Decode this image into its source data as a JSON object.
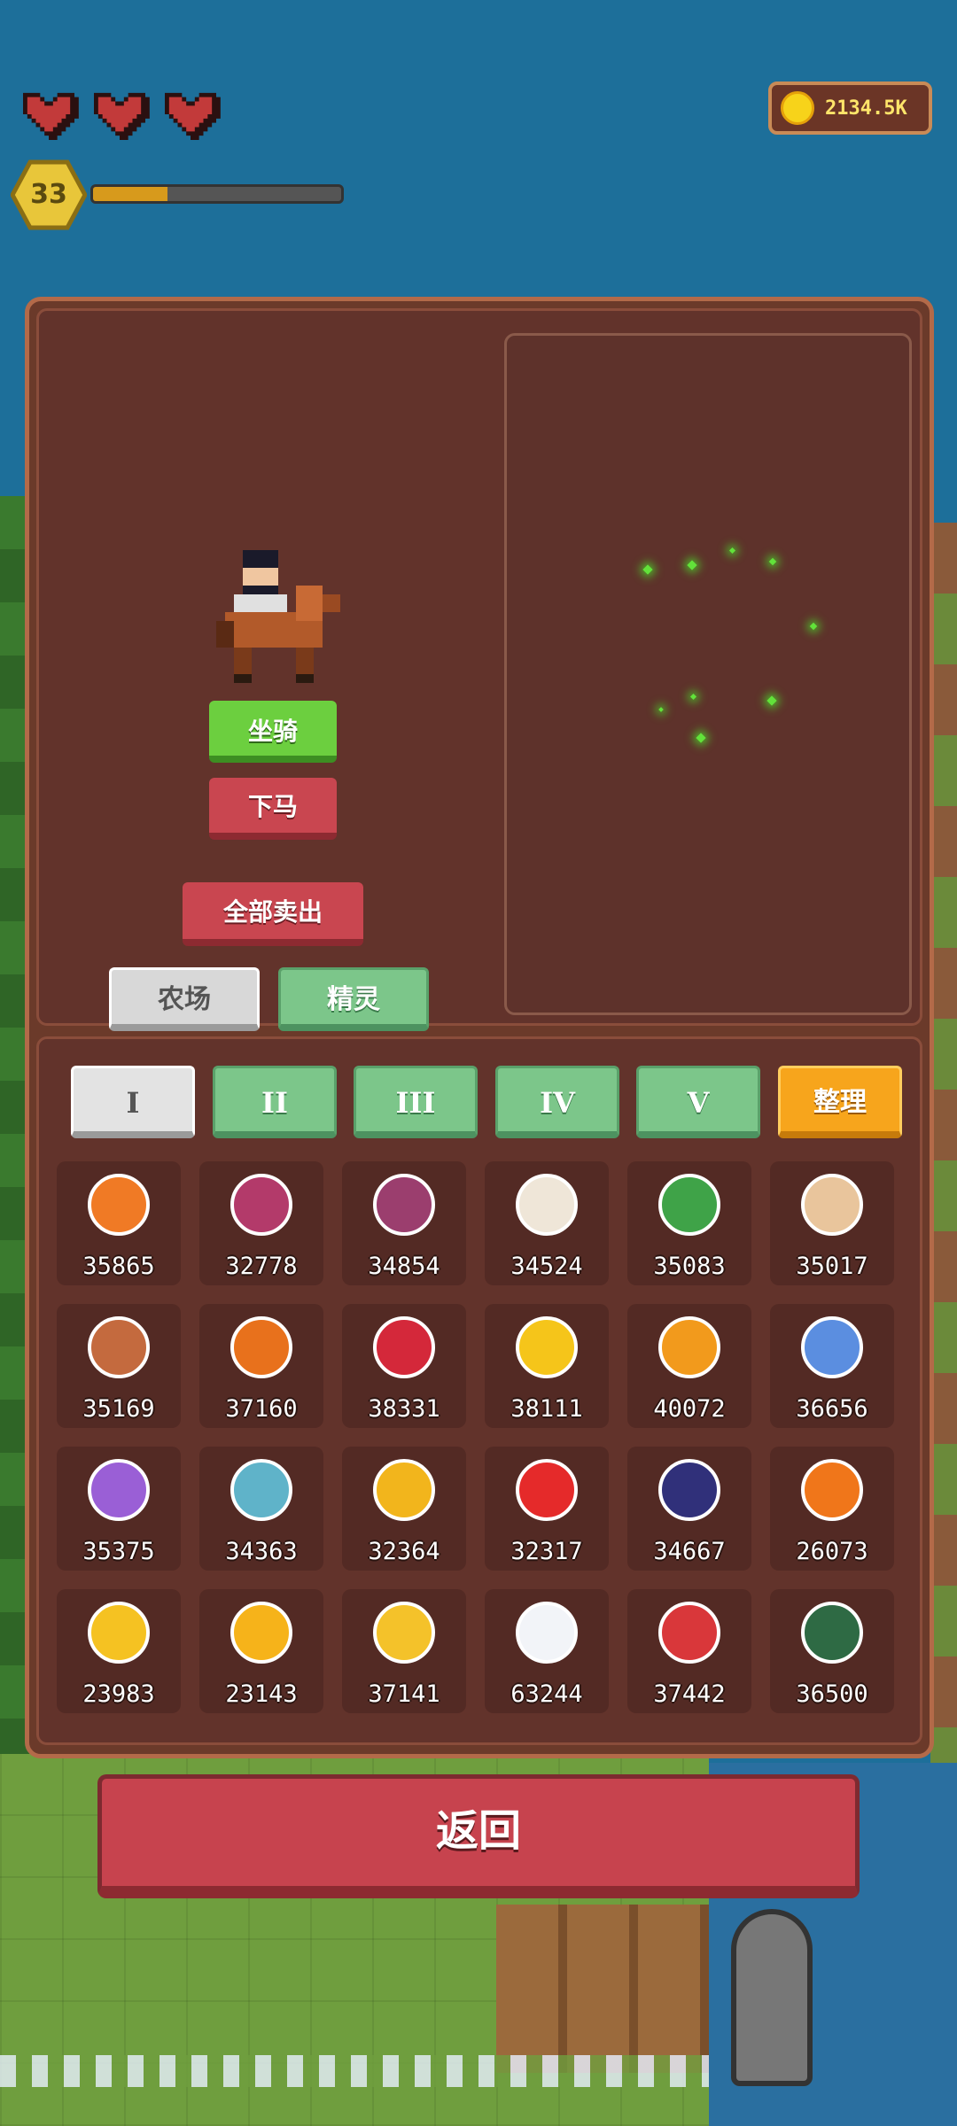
{
  "hud": {
    "hearts": 3,
    "level": "33",
    "xp_progress": 0.3,
    "coins": "2134.5K"
  },
  "mount": {
    "mount_label": "坐骑",
    "dismount_label": "下马",
    "sell_all_label": "全部卖出",
    "tabs": [
      "农场",
      "精灵"
    ]
  },
  "categories": [
    "I",
    "II",
    "III",
    "IV",
    "V"
  ],
  "sort_label": "整理",
  "items": [
    {
      "name": "carrot",
      "count": "35865",
      "color": "#f07a25"
    },
    {
      "name": "beet",
      "count": "32778",
      "color": "#b33a6a"
    },
    {
      "name": "red-cabbage",
      "count": "34854",
      "color": "#9b3e6e"
    },
    {
      "name": "cauliflower",
      "count": "34524",
      "color": "#efe6d8"
    },
    {
      "name": "lettuce",
      "count": "35083",
      "color": "#3fa348"
    },
    {
      "name": "parsnip",
      "count": "35017",
      "color": "#e9c59c"
    },
    {
      "name": "potato",
      "count": "35169",
      "color": "#c46a3e"
    },
    {
      "name": "pumpkin",
      "count": "37160",
      "color": "#e8711c"
    },
    {
      "name": "radish",
      "count": "38331",
      "color": "#d4283a"
    },
    {
      "name": "sunflower",
      "count": "38111",
      "color": "#f5c51a"
    },
    {
      "name": "wheat",
      "count": "40072",
      "color": "#f29a1c"
    },
    {
      "name": "blueberry",
      "count": "36656",
      "color": "#5b8ee0"
    },
    {
      "name": "purple-grapes",
      "count": "35375",
      "color": "#9a5fd6"
    },
    {
      "name": "starfruit",
      "count": "34363",
      "color": "#5fb3c9"
    },
    {
      "name": "pear",
      "count": "32364",
      "color": "#f2b51c"
    },
    {
      "name": "apple",
      "count": "32317",
      "color": "#e52a2a"
    },
    {
      "name": "grapes",
      "count": "34667",
      "color": "#30307a"
    },
    {
      "name": "orange",
      "count": "26073",
      "color": "#f0761a"
    },
    {
      "name": "pineapple",
      "count": "23983",
      "color": "#f5c222"
    },
    {
      "name": "mango",
      "count": "23143",
      "color": "#f6b31a"
    },
    {
      "name": "corn",
      "count": "37141",
      "color": "#f4c22a"
    },
    {
      "name": "cotton",
      "count": "63244",
      "color": "#f2f4f8"
    },
    {
      "name": "strawberry",
      "count": "37442",
      "color": "#d9373a"
    },
    {
      "name": "melon",
      "count": "36500",
      "color": "#2e6a44"
    }
  ],
  "back_label": "返回"
}
